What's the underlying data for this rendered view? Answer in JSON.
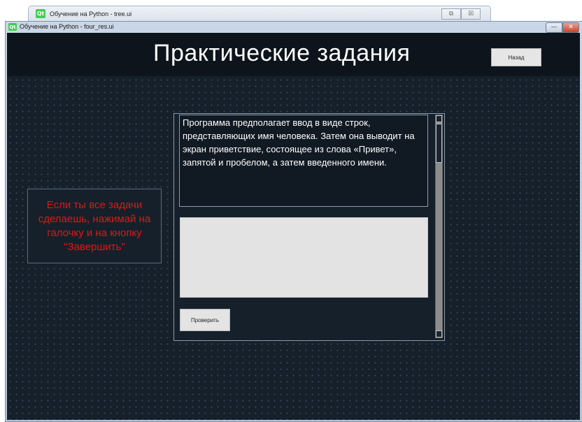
{
  "background_window": {
    "title": "Обучение на Python - tree.ui",
    "controls": [
      "⧉",
      "☒"
    ]
  },
  "window": {
    "title": "Обучение на Python - four_res.ui",
    "app_icon": "qt-logo",
    "logo_text": "Qt",
    "controls": {
      "minimize": "—",
      "close": "✕"
    }
  },
  "header": {
    "title": "Практические задания",
    "back_label": "Назад"
  },
  "hint": {
    "text": "Если ты все задачи сделаешь, нажимай на галочку и на кнопку \"Завершить\""
  },
  "task": {
    "description": "Программа предполагает ввод в виде строк, представляющих имя человека. Затем она выводит на экран приветствие, состоящее из слова «Привет», запятой и пробелом, а затем введенного имени.",
    "answer_value": "",
    "check_label": "Проверить"
  },
  "colors": {
    "background": "#16202b",
    "header": "#0e141b",
    "hint_text": "#e01616",
    "title_text": "#ffffff"
  }
}
